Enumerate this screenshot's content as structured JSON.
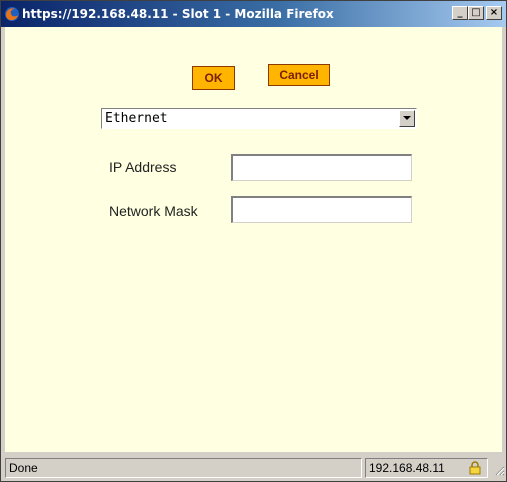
{
  "window": {
    "title": "https://192.168.48.11 - Slot 1 - Mozilla Firefox",
    "minimize_glyph": "_",
    "maximize_glyph": "□",
    "close_glyph": "×"
  },
  "dialog": {
    "ok_label": "OK",
    "cancel_label": "Cancel",
    "interface_select": {
      "selected": "Ethernet"
    },
    "fields": [
      {
        "label": "IP Address",
        "value": ""
      },
      {
        "label": "Network Mask",
        "value": ""
      }
    ]
  },
  "statusbar": {
    "status_text": "Done",
    "host": "192.168.48.11"
  },
  "colors": {
    "page_background": "#ffffe1",
    "button_fill": "#ffb400",
    "button_text": "#7a2000",
    "titlebar_start": "#0a246a",
    "titlebar_end": "#a6caf0"
  },
  "icons": {
    "title": "firefox-icon",
    "dropdown": "chevron-down-icon",
    "security": "lock-icon",
    "resize": "resize-grip-icon"
  }
}
